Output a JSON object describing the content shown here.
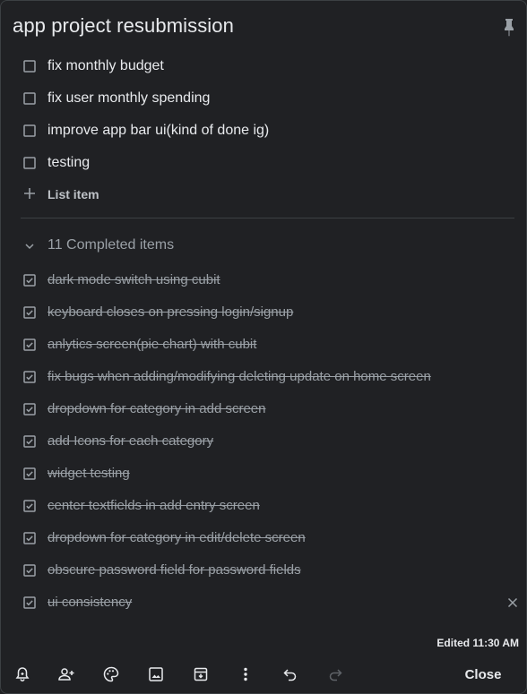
{
  "note": {
    "title": "app project resubmission",
    "open_items": [
      {
        "label": "fix monthly budget"
      },
      {
        "label": "fix user monthly spending"
      },
      {
        "label": "improve app bar ui(kind of done ig)"
      },
      {
        "label": "testing"
      }
    ],
    "add_item_label": "List item",
    "completed_header": "11 Completed items",
    "completed_items": [
      {
        "label": "dark mode switch using cubit"
      },
      {
        "label": "keyboard closes on pressing login/signup"
      },
      {
        "label": "anlytics screen(pie chart) with cubit"
      },
      {
        "label": "fix bugs when adding/modifying deleting update on home screen"
      },
      {
        "label": "dropdown for category in add screen"
      },
      {
        "label": "add Icons for each category"
      },
      {
        "label": "widget testing"
      },
      {
        "label": "center textfields in add entry screen"
      },
      {
        "label": "dropdown for category in edit/delete screen"
      },
      {
        "label": "obscure password field for password fields"
      },
      {
        "label": "ui consistency"
      }
    ],
    "edited_text": "Edited 11:30 AM"
  },
  "toolbar": {
    "icons": [
      "reminder-bell-icon",
      "collaborator-icon",
      "palette-icon",
      "image-icon",
      "archive-icon",
      "more-vertical-icon",
      "undo-icon",
      "redo-icon"
    ],
    "close_label": "Close"
  },
  "colors": {
    "background": "#202124",
    "text": "#e8eaed",
    "muted": "#9aa0a6",
    "divider": "#3c4043"
  }
}
